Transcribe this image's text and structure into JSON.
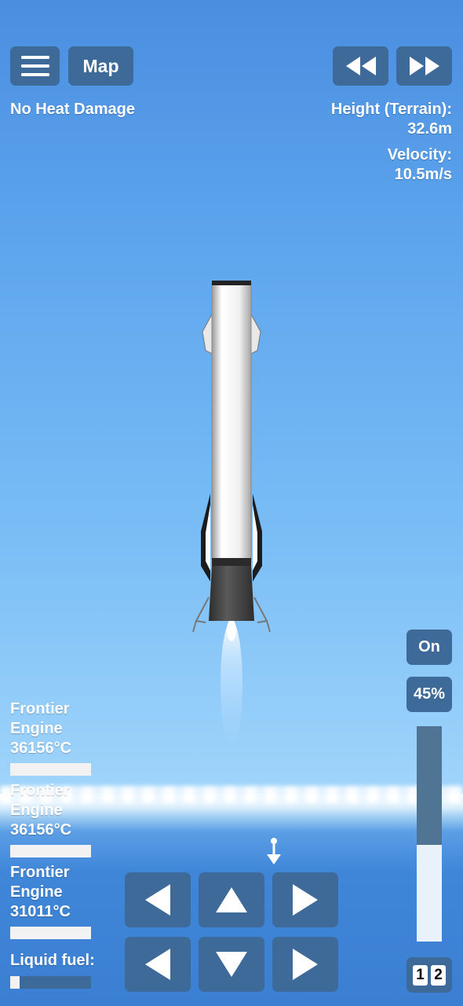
{
  "topbar": {
    "menu_icon": "hamburger-menu-icon",
    "map_label": "Map",
    "rewind_icon": "rewind-icon",
    "fastforward_icon": "fast-forward-icon"
  },
  "status": {
    "heat": "No Heat Damage",
    "height_label": "Height (Terrain):",
    "height_value": "32.6m",
    "velocity_label": "Velocity:",
    "velocity_value": "10.5m/s"
  },
  "engines": [
    {
      "name_line1": "Frontier",
      "name_line2": "Engine",
      "temp": "36156°C"
    },
    {
      "name_line1": "Frontier",
      "name_line2": "Engine",
      "temp": "36156°C"
    },
    {
      "name_line1": "Frontier",
      "name_line2": "Engine",
      "temp": "31011°C"
    }
  ],
  "fuel": {
    "label": "Liquid fuel:",
    "level": 0.12
  },
  "throttle": {
    "toggle_label": "On",
    "percent_label": "45%",
    "level": 0.45
  },
  "stage": {
    "a": "1",
    "b": "2"
  },
  "colors": {
    "button": "#3d6a99",
    "sky_top": "#4a8ee0",
    "sea": "#3b7fd3"
  }
}
